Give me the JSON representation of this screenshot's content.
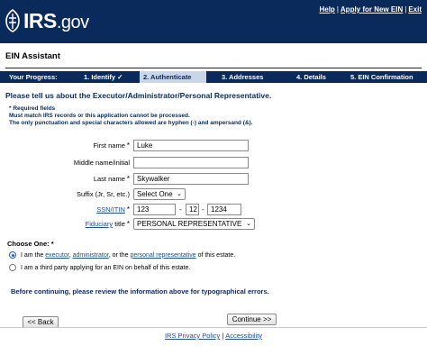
{
  "header": {
    "logo_main": "IRS",
    "logo_suffix": ".gov",
    "links": {
      "help": "Help",
      "apply_new": "Apply for New EIN",
      "exit": "Exit"
    },
    "background_color": "#0a2a5c"
  },
  "page_title": "EIN Assistant",
  "progress": {
    "label": "Your Progress:",
    "steps": [
      "1. Identify",
      "2. Authenticate",
      "3. Addresses",
      "4. Details",
      "5. EIN Confirmation"
    ],
    "completed_mark": "✓",
    "active_index": 1
  },
  "heading": "Please tell us about the Executor/Administrator/Personal Representative.",
  "required_note": {
    "star": "*",
    "text": "Required fields",
    "line1": "Must match IRS records or this application cannot be processed.",
    "line2": "The only punctuation and special characters allowed are hyphen (-) and ampersand (&)."
  },
  "form": {
    "first_name": {
      "label": "First name",
      "required": "*",
      "value": "Luke"
    },
    "middle_name": {
      "label": "Middle name/initial",
      "value": ""
    },
    "last_name": {
      "label": "Last name",
      "required": "*",
      "value": "Skywalker"
    },
    "suffix": {
      "label": "Suffix (Jr, Sr, etc.)",
      "value": "Select One"
    },
    "ssn": {
      "label": "SSN/ITIN",
      "required": "*",
      "part1": "123",
      "part2": "12",
      "part3": "1234",
      "separator": "-"
    },
    "title": {
      "label_link": "Fiduciary",
      "label_rest": "title",
      "required": "*",
      "value": "PERSONAL REPRESENTATIVE"
    }
  },
  "choose_one": {
    "label": "Choose One:",
    "required": "*",
    "option1": {
      "prefix": "I am the",
      "link1": "executor",
      "sep1": ",",
      "link2": "administrator",
      "sep2": ", or the",
      "link3": "personal representative",
      "suffix": "of this estate.",
      "checked": true
    },
    "option2": {
      "text": "I am a third party applying for an EIN on behalf of this estate.",
      "checked": false
    }
  },
  "notice": "Before continuing, please review the information above for typographical errors.",
  "buttons": {
    "back": "<< Back",
    "continue": "Continue >>"
  },
  "footer": {
    "privacy": "IRS Privacy Policy",
    "accessibility": "Accessibility",
    "separator": "|"
  }
}
